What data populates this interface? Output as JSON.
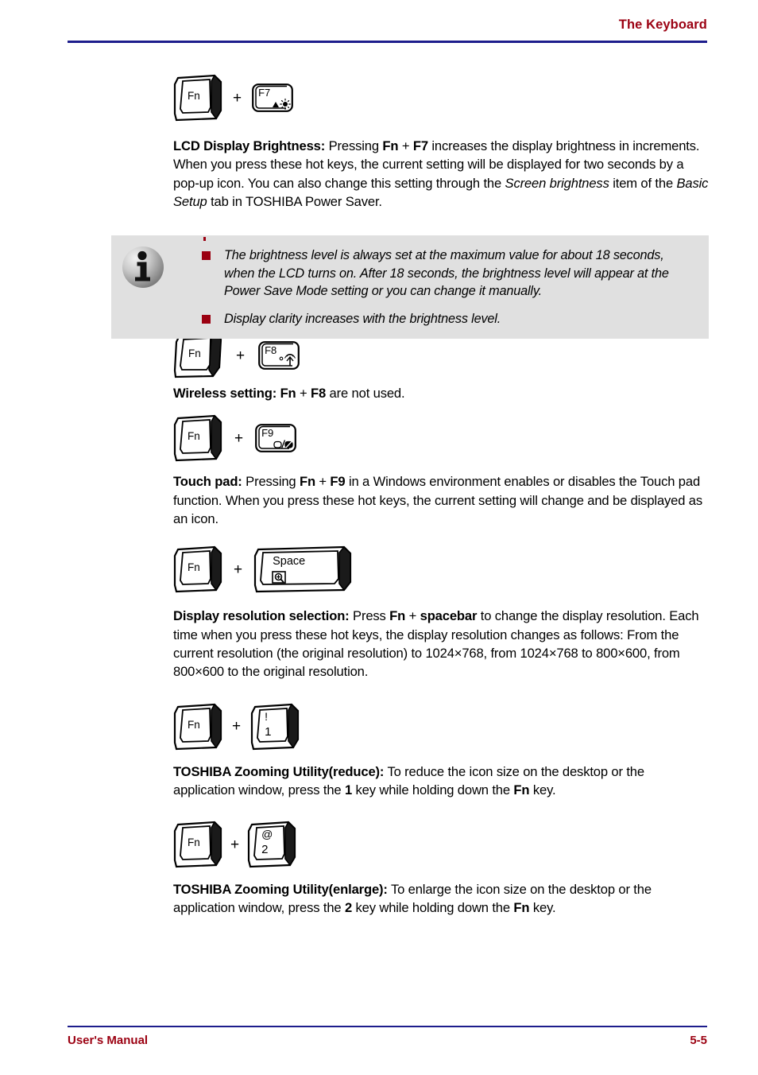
{
  "header": {
    "title": "The Keyboard",
    "rule_color": "#1d1d8c",
    "text_color": "#9b0011"
  },
  "footer": {
    "left": "User's Manual",
    "page_number": "5-5",
    "rule_color": "#1d1d8c",
    "text_color": "#9b0011"
  },
  "plus_symbol": "+",
  "sections": [
    {
      "keys": {
        "first": {
          "label": "Fn",
          "type": "keycap-3d"
        },
        "second": {
          "label": "F7",
          "type": "function-key",
          "icon": "brightness-up-icon"
        }
      },
      "heading": "LCD Display Brightness:",
      "text_parts": [
        {
          "t": " Pressing ",
          "style": "normal"
        },
        {
          "t": "Fn",
          "style": "bold"
        },
        {
          "t": " + ",
          "style": "normal"
        },
        {
          "t": "F7",
          "style": "bold"
        },
        {
          "t": " increases the display brightness in increments. When you press these hot keys, the current setting will be displayed for two seconds by a pop-up icon. You can also change this setting through the ",
          "style": "normal"
        },
        {
          "t": "Screen brightness",
          "style": "italic"
        },
        {
          "t": " item of the ",
          "style": "normal"
        },
        {
          "t": "Basic Setup",
          "style": "italic"
        },
        {
          "t": " tab in TOSHIBA Power Saver.",
          "style": "normal"
        }
      ]
    },
    {
      "keys": {
        "first": {
          "label": "Fn",
          "type": "keycap-3d"
        },
        "second": {
          "label": "F8",
          "type": "function-key",
          "icon": "wireless-icon"
        }
      },
      "heading": "Wireless setting:",
      "text_parts": [
        {
          "t": "  ",
          "style": "normal"
        },
        {
          "t": "Fn",
          "style": "bold"
        },
        {
          "t": " + ",
          "style": "normal"
        },
        {
          "t": "F8",
          "style": "bold"
        },
        {
          "t": " are not used.",
          "style": "normal"
        }
      ]
    },
    {
      "keys": {
        "first": {
          "label": "Fn",
          "type": "keycap-3d"
        },
        "second": {
          "label": "F9",
          "type": "function-key",
          "icon": "touchpad-toggle-icon"
        }
      },
      "heading": "Touch pad:",
      "text_parts": [
        {
          "t": " Pressing ",
          "style": "normal"
        },
        {
          "t": "Fn",
          "style": "bold"
        },
        {
          "t": " + ",
          "style": "normal"
        },
        {
          "t": "F9",
          "style": "bold"
        },
        {
          "t": " in a Windows environment enables or disables the Touch pad function. When you press these hot keys, the current setting will change and be displayed as an icon.",
          "style": "normal"
        }
      ]
    },
    {
      "keys": {
        "first": {
          "label": "Fn",
          "type": "keycap-3d"
        },
        "second": {
          "label": "Space",
          "type": "keycap-3d-wide",
          "icon": "resolution-zoom-icon"
        }
      },
      "heading": "Display resolution selection:",
      "text_parts": [
        {
          "t": " Press ",
          "style": "normal"
        },
        {
          "t": "Fn",
          "style": "bold"
        },
        {
          "t": " + ",
          "style": "normal"
        },
        {
          "t": "spacebar",
          "style": "bold"
        },
        {
          "t": " to change the display resolution. Each time when you press these hot keys, the display resolution changes as follows: From the current resolution (the original resolution) to 1024×768, from 1024×768 to 800×600, from 800×600 to the original resolution.",
          "style": "normal"
        }
      ]
    },
    {
      "keys": {
        "first": {
          "label": "Fn",
          "type": "keycap-3d"
        },
        "second": {
          "label": "1",
          "shift_label": "!",
          "type": "keycap-3d-number"
        }
      },
      "heading": "TOSHIBA Zooming Utility(reduce):",
      "text_parts": [
        {
          "t": " To reduce the icon size on the desktop or the application window, press the ",
          "style": "normal"
        },
        {
          "t": "1",
          "style": "bold"
        },
        {
          "t": " key while holding down the ",
          "style": "normal"
        },
        {
          "t": "Fn",
          "style": "bold"
        },
        {
          "t": " key.",
          "style": "normal"
        }
      ]
    },
    {
      "keys": {
        "first": {
          "label": "Fn",
          "type": "keycap-3d"
        },
        "second": {
          "label": "2",
          "shift_label": "@",
          "type": "keycap-3d-number"
        }
      },
      "heading": "TOSHIBA Zooming Utility(enlarge):",
      "text_parts": [
        {
          "t": " To enlarge the icon size on the desktop or the application window, press the ",
          "style": "normal"
        },
        {
          "t": "2",
          "style": "bold"
        },
        {
          "t": " key while holding down the ",
          "style": "normal"
        },
        {
          "t": "Fn",
          "style": "bold"
        },
        {
          "t": " key.",
          "style": "normal"
        }
      ]
    }
  ],
  "note": {
    "icon": "info-icon",
    "background": "#e0e0e0",
    "bullet_color": "#9b0011",
    "items": [
      "The brightness level is always set at the maximum value for about 18 seconds, when the LCD turns on. After 18 seconds, the brightness level will appear at the Power Save Mode setting or you can change it manually.",
      "Display clarity increases with the brightness level."
    ]
  }
}
